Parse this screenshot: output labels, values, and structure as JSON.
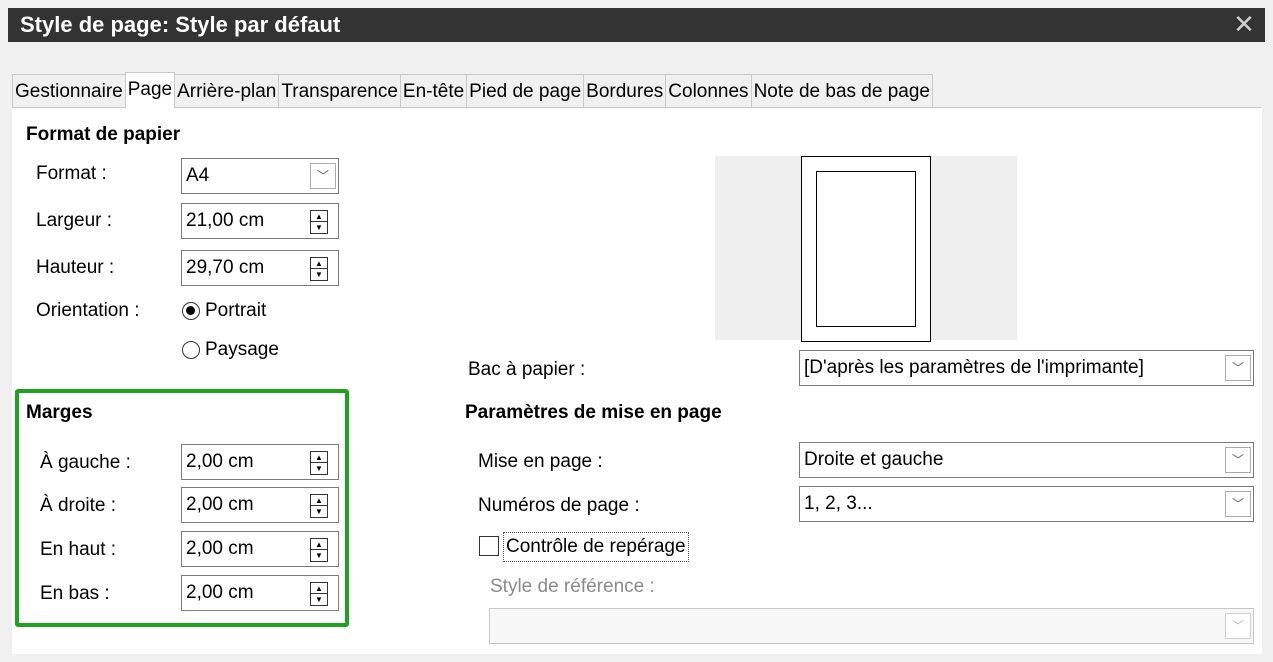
{
  "window": {
    "title": "Style de page: Style par défaut",
    "close_icon": "close-icon"
  },
  "tabs": [
    {
      "label": "Gestionnaire",
      "active": false
    },
    {
      "label": "Page",
      "active": true
    },
    {
      "label": "Arrière-plan",
      "active": false
    },
    {
      "label": "Transparence",
      "active": false
    },
    {
      "label": "En-tête",
      "active": false
    },
    {
      "label": "Pied de page",
      "active": false
    },
    {
      "label": "Bordures",
      "active": false
    },
    {
      "label": "Colonnes",
      "active": false
    },
    {
      "label": "Note de bas de page",
      "active": false
    }
  ],
  "paper": {
    "heading": "Format de papier",
    "format_label": "Format :",
    "format_value": "A4",
    "width_label": "Largeur :",
    "width_value": "21,00 cm",
    "height_label": "Hauteur :",
    "height_value": "29,70 cm",
    "orientation_label": "Orientation :",
    "portrait_label": "Portrait",
    "landscape_label": "Paysage",
    "selected_orientation": "Portrait"
  },
  "margins": {
    "heading": "Marges",
    "left_label": "À gauche :",
    "left_value": "2,00 cm",
    "right_label": "À droite :",
    "right_value": "2,00 cm",
    "top_label": "En haut :",
    "top_value": "2,00 cm",
    "bottom_label": "En bas :",
    "bottom_value": "2,00 cm",
    "highlight_color": "#1fa31f"
  },
  "tray": {
    "label": "Bac à papier :",
    "value": "[D'après les paramètres de l'imprimante]"
  },
  "layout": {
    "heading": "Paramètres de mise en page",
    "layout_label": "Mise en page :",
    "layout_value": "Droite et gauche",
    "numbers_label": "Numéros de page :",
    "numbers_value": "1, 2, 3...",
    "register_label": "Contrôle de repérage",
    "register_checked": false,
    "reference_label": "Style de référence :",
    "reference_value": ""
  }
}
